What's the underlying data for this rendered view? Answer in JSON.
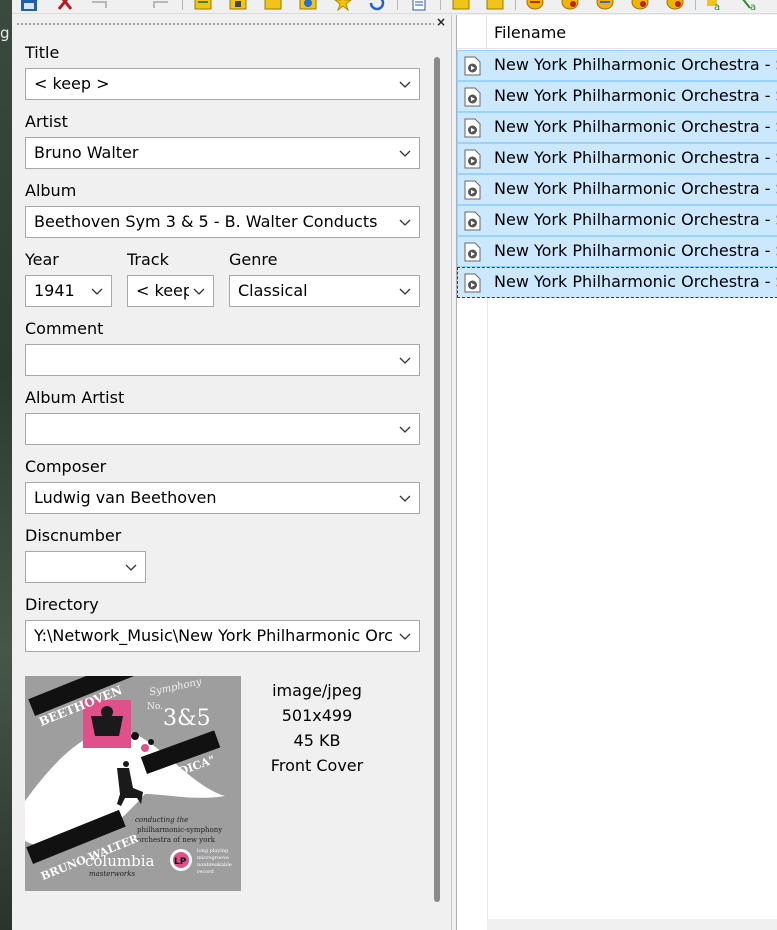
{
  "desktop_edge_text": "g",
  "toolbar": {
    "icons": [
      "save-icon",
      "delete-icon",
      "undo-icon",
      "redo-icon",
      "folder-open-icon",
      "folder-save-icon",
      "folder-icon",
      "playlist-icon",
      "favorite-star-icon",
      "refresh-icon",
      "document-icon",
      "folder-up-icon",
      "folder-yellow-icon",
      "convert-icon-1",
      "convert-icon-2",
      "convert-icon-3",
      "convert-icon-4",
      "convert-icon-5",
      "text-case-icon-1",
      "text-case-icon-2"
    ]
  },
  "tag_panel": {
    "close_glyph": "×",
    "title": {
      "label": "Title",
      "value": "< keep >"
    },
    "artist": {
      "label": "Artist",
      "value": "Bruno Walter"
    },
    "album": {
      "label": "Album",
      "value": "Beethoven Sym 3 & 5 - B. Walter Conducts"
    },
    "year": {
      "label": "Year",
      "value": "1941"
    },
    "track": {
      "label": "Track",
      "value": "< keep >"
    },
    "genre": {
      "label": "Genre",
      "value": "Classical"
    },
    "comment": {
      "label": "Comment",
      "value": ""
    },
    "album_artist": {
      "label": "Album Artist",
      "value": ""
    },
    "composer": {
      "label": "Composer",
      "value": "Ludwig van Beethoven"
    },
    "discnumber": {
      "label": "Discnumber",
      "value": ""
    },
    "directory": {
      "label": "Directory",
      "value": "Y:\\Network_Music\\New York Philharmonic Orchestra"
    },
    "cover_art": {
      "lines": [
        "BEETHOVEN",
        "Symphony",
        "No.",
        "3&5",
        "\"EROICA\"",
        "conducting the",
        "philharmonic-symphony",
        "orchestra of new york",
        "BRUNO WALTER",
        "columbia",
        "masterworks",
        "LP",
        "long playing",
        "microgroove",
        "nonbreakable",
        "record"
      ],
      "mime": "image/jpeg",
      "dimensions": "501x499",
      "size": "45 KB",
      "picture_type": "Front Cover"
    }
  },
  "file_list": {
    "column_header": "Filename",
    "rows": [
      "New York Philharmonic Orchestra - S",
      "New York Philharmonic Orchestra - S",
      "New York Philharmonic Orchestra - S",
      "New York Philharmonic Orchestra - S",
      "New York Philharmonic Orchestra - S",
      "New York Philharmonic Orchestra - S",
      "New York Philharmonic Orchestra - S",
      "New York Philharmonic Orchestra - S"
    ],
    "selection_color": "#cce8ff",
    "selection_border": "#99d1ff"
  }
}
